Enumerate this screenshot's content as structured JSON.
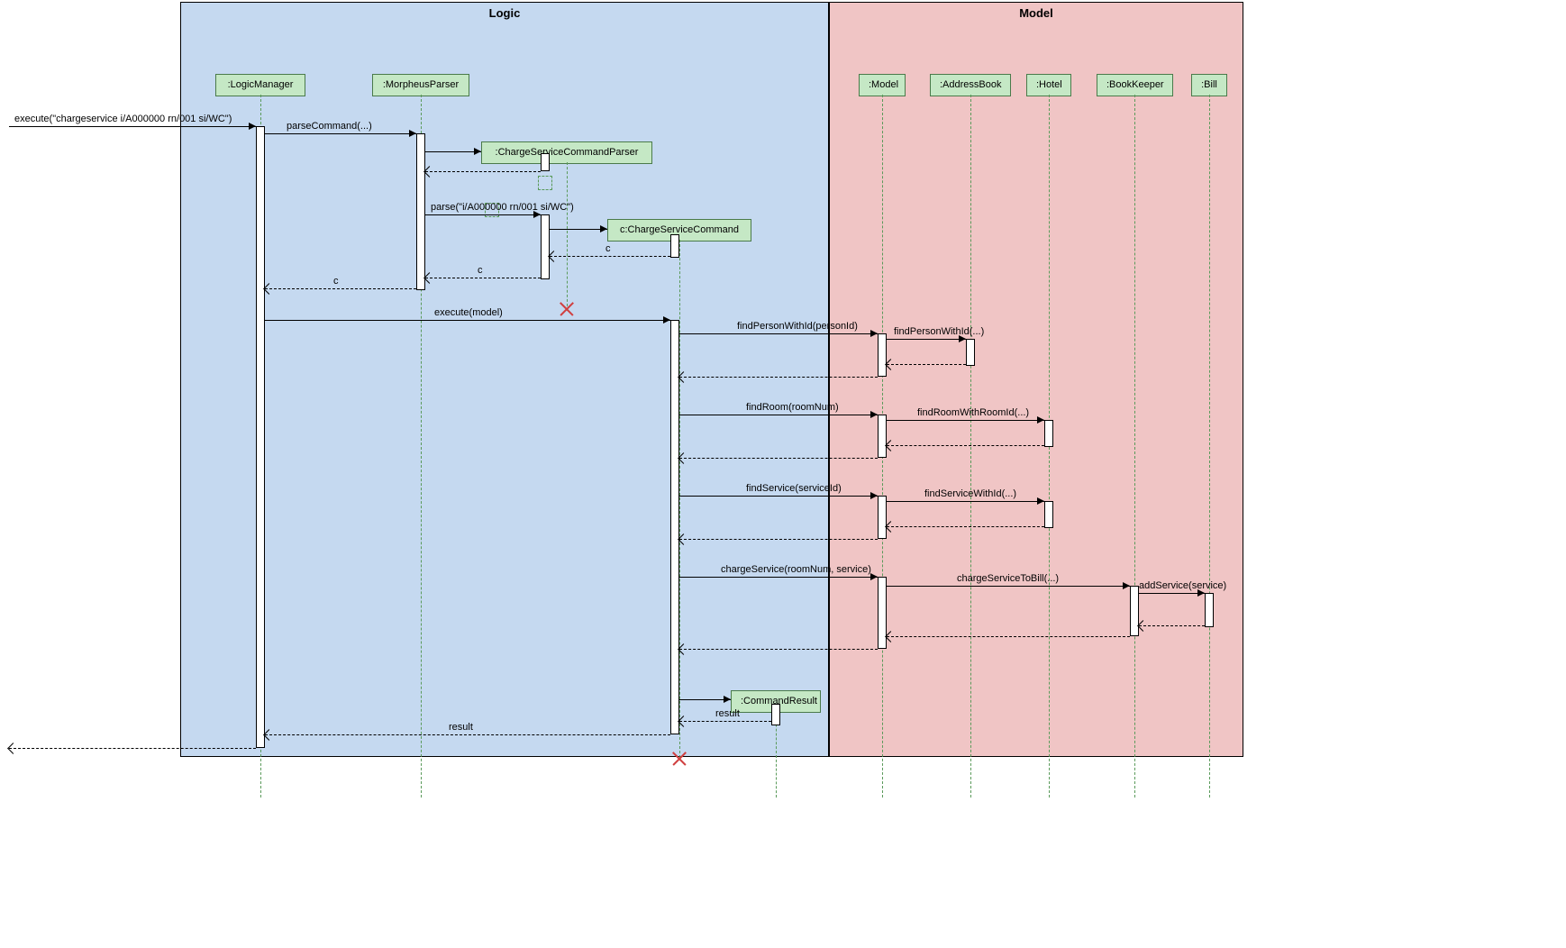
{
  "frames": {
    "logic": {
      "title": "Logic"
    },
    "model": {
      "title": "Model"
    }
  },
  "participants": {
    "logicManager": ":LogicManager",
    "morpheusParser": ":MorpheusParser",
    "chargeServiceCommandParser": ":ChargeServiceCommandParser",
    "chargeServiceCommand": "c:ChargeServiceCommand",
    "commandResult": ":CommandResult",
    "model": ":Model",
    "addressBook": ":AddressBook",
    "hotel": ":Hotel",
    "bookKeeper": ":BookKeeper",
    "bill": ":Bill"
  },
  "messages": {
    "execute1": "execute(\"chargeservice i/A000000 rn/001 si/WC\")",
    "parseCommand": "parseCommand(...)",
    "parse": "parse(\"i/A000000 rn/001 si/WC\")",
    "returnC1": "c",
    "returnC2": "c",
    "executeModel": "execute(model)",
    "findPersonWithId": "findPersonWithId(personId)",
    "findPersonWithId2": "findPersonWithId(...)",
    "findRoom": "findRoom(roomNum)",
    "findRoomWithRoomId": "findRoomWithRoomId(...)",
    "findService": "findService(serviceId)",
    "findServiceWithId": "findServiceWithId(...)",
    "chargeService": "chargeService(roomNum, service)",
    "chargeServiceToBill": "chargeServiceToBill(...)",
    "addService": "addService(service)",
    "resultLabel": "result",
    "resultLabel2": "result"
  }
}
